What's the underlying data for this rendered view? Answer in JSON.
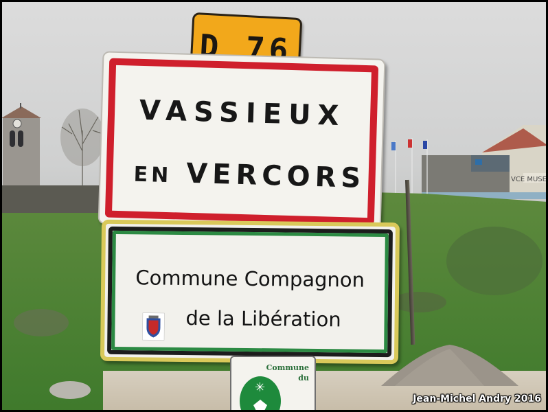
{
  "road_sign": {
    "text": "D 76",
    "color": "#f2a81b"
  },
  "town_sign": {
    "line1": "VASSIEUX",
    "line2_small": "EN",
    "line2_main": "VERCORS",
    "border_color": "#cf1f2c"
  },
  "commune_sign": {
    "line1": "Commune Compagnon",
    "line2": "de la Libération",
    "border_color": "#2c8a43"
  },
  "small_sign": {
    "line1": "Commune",
    "line2": "du"
  },
  "credit": "Jean-Michel Andry 2016",
  "building_sign": "VCE MUSEE DE"
}
